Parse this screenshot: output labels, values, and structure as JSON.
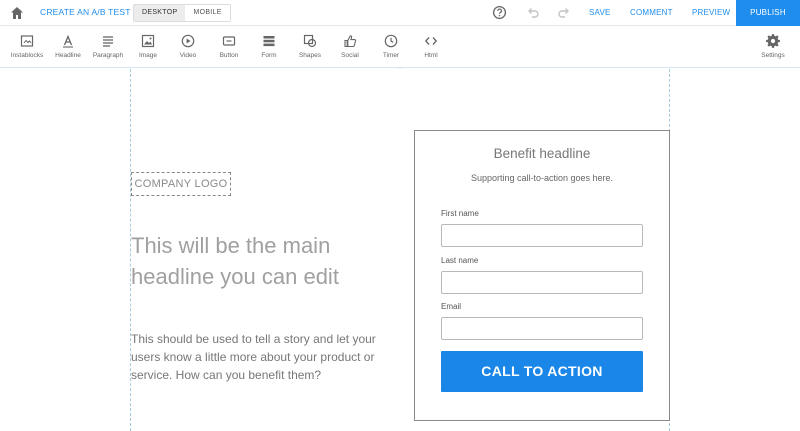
{
  "topbar": {
    "ab_test_label": "CREATE AN A/B TEST",
    "device_desktop": "DESKTOP",
    "device_mobile": "MOBILE",
    "save_label": "SAVE",
    "comment_label": "COMMENT",
    "preview_label": "PREVIEW",
    "publish_label": "PUBLISH",
    "accent_color": "#1f8ded"
  },
  "toolbar": {
    "tools": [
      {
        "label": "Instablocks",
        "icon": "instablocks-icon"
      },
      {
        "label": "Headline",
        "icon": "headline-icon"
      },
      {
        "label": "Paragraph",
        "icon": "paragraph-icon"
      },
      {
        "label": "Image",
        "icon": "image-icon"
      },
      {
        "label": "Video",
        "icon": "video-icon"
      },
      {
        "label": "Button",
        "icon": "button-icon"
      },
      {
        "label": "Form",
        "icon": "form-icon"
      },
      {
        "label": "Shapes",
        "icon": "shapes-icon"
      },
      {
        "label": "Social",
        "icon": "social-icon"
      },
      {
        "label": "Timer",
        "icon": "timer-icon"
      },
      {
        "label": "Html",
        "icon": "html-icon"
      }
    ],
    "settings_label": "Settings"
  },
  "page": {
    "logo_placeholder": "COMPANY LOGO",
    "headline": "This will be the main headline you can edit",
    "paragraph": "This should be used to tell a story and let your users know a little more about your product or service. How can you benefit them?"
  },
  "form": {
    "title": "Benefit headline",
    "subtitle": "Supporting call-to-action goes here.",
    "fields": [
      {
        "label": "First name",
        "value": ""
      },
      {
        "label": "Last name",
        "value": ""
      },
      {
        "label": "Email",
        "value": ""
      }
    ],
    "cta_label": "CALL TO ACTION",
    "cta_color": "#1a86e8"
  }
}
